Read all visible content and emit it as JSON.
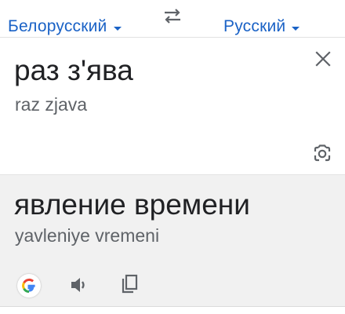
{
  "languages": {
    "source": "Белорусский",
    "target": "Русский"
  },
  "source": {
    "text": "раз з'ява",
    "transliteration": "raz zjava"
  },
  "result": {
    "text": "явление времени",
    "transliteration": "yavleniye vremeni"
  },
  "icons": {
    "swap": "swap-arrows-icon",
    "clear": "close-icon",
    "camera": "camera-icon",
    "google": "google-logo-icon",
    "speaker": "speaker-icon",
    "copy": "copy-icon",
    "dropdown": "caret-down-icon"
  },
  "colors": {
    "accent": "#1a62c6",
    "text_primary": "#202124",
    "text_secondary": "#5f6368",
    "result_background": "#f1f1f1",
    "icon": "#5f6368"
  }
}
